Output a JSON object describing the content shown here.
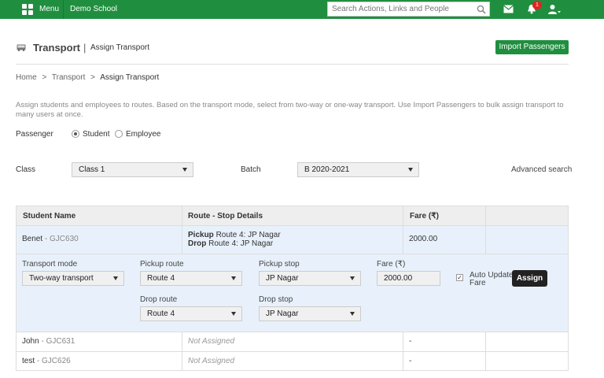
{
  "topbar": {
    "menu_label": "Menu",
    "school_name": "Demo School",
    "search_placeholder": "Search Actions, Links and People",
    "notification_count": "1"
  },
  "page": {
    "title": "Transport",
    "separator": "|",
    "subtitle": "Assign Transport",
    "import_button": "Import Passengers"
  },
  "breadcrumb": {
    "items": [
      "Home",
      "Transport",
      "Assign Transport"
    ],
    "separator": ">"
  },
  "description": "Assign students and employees to routes. Based on the transport mode, select from two-way or one-way transport. Use Import Passengers to bulk assign transport to many users at once.",
  "passenger": {
    "label": "Passenger",
    "options": [
      "Student",
      "Employee"
    ],
    "selected": "Student"
  },
  "filters": {
    "class_label": "Class",
    "class_value": "Class 1",
    "batch_label": "Batch",
    "batch_value": "B 2020-2021",
    "advanced_search": "Advanced search"
  },
  "table": {
    "headers": [
      "Student Name",
      "Route - Stop Details",
      "Fare (₹)",
      ""
    ],
    "rows": [
      {
        "name": "Benet",
        "dash": " - ",
        "code": "GJC630",
        "pickup_label": "Pickup",
        "pickup_value": " Route 4: JP Nagar",
        "drop_label": "Drop",
        "drop_value": " Route 4: JP Nagar",
        "fare": "2000.00"
      },
      {
        "name": "John",
        "dash": " - ",
        "code": "GJC631",
        "route": "Not Assigned",
        "fare": "-"
      },
      {
        "name": "test",
        "dash": " - ",
        "code": "GJC626",
        "route": "Not Assigned",
        "fare": "-"
      }
    ]
  },
  "editor": {
    "transport_mode_label": "Transport mode",
    "transport_mode_value": "Two-way transport",
    "pickup_route_label": "Pickup route",
    "pickup_route_value": "Route 4",
    "pickup_stop_label": "Pickup stop",
    "pickup_stop_value": "JP Nagar",
    "fare_label": "Fare (₹)",
    "fare_value": "2000.00",
    "auto_update_label_1": "Auto Update",
    "auto_update_label_2": "Fare",
    "auto_update_checked": true,
    "drop_route_label": "Drop route",
    "drop_route_value": "Route 4",
    "drop_stop_label": "Drop stop",
    "drop_stop_value": "JP Nagar",
    "assign_button": "Assign"
  },
  "colors": {
    "brand_green": "#1f8f3f",
    "selected_row_bg": "#e8f1fb",
    "badge_red": "#e02424"
  }
}
